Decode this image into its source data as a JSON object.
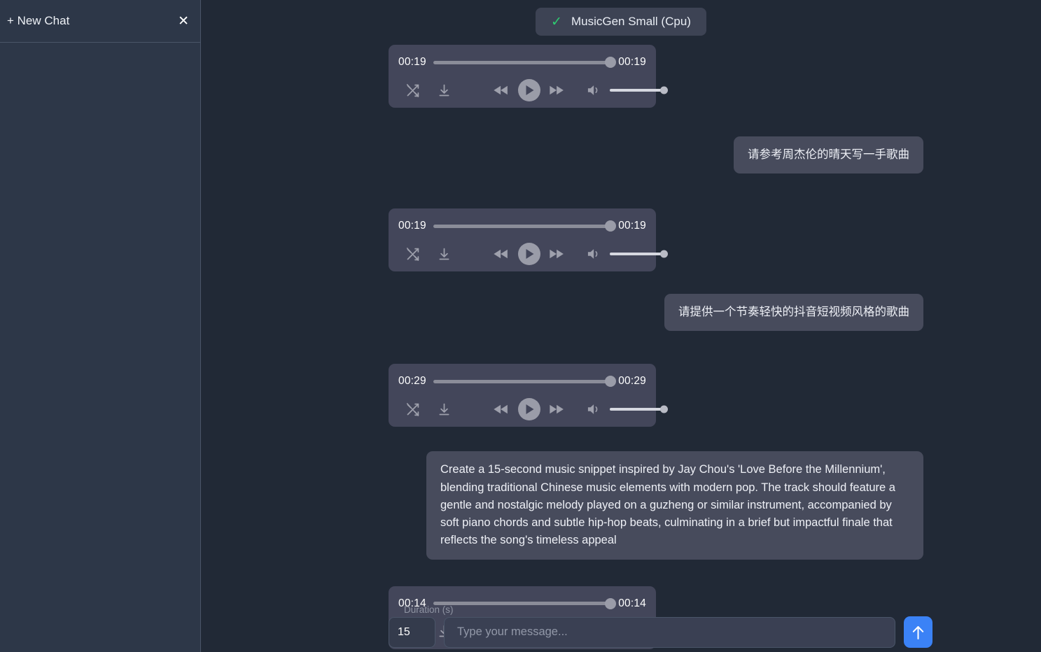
{
  "sidebar": {
    "new_chat_label": "+ New Chat",
    "close_icon": "close-icon"
  },
  "header": {
    "model_badge": {
      "check_icon": "check-icon",
      "label": "MusicGen Small (Cpu)"
    }
  },
  "conversation": [
    {
      "type": "audio",
      "align": "left",
      "current_time": "00:19",
      "total_time": "00:19",
      "progress_percent": 100,
      "volume_percent": 100
    },
    {
      "type": "message",
      "align": "right",
      "text": "请参考周杰伦的晴天写一手歌曲"
    },
    {
      "type": "audio",
      "align": "left",
      "current_time": "00:19",
      "total_time": "00:19",
      "progress_percent": 100,
      "volume_percent": 100
    },
    {
      "type": "message",
      "align": "right",
      "text": "请提供一个节奏轻快的抖音短视频风格的歌曲"
    },
    {
      "type": "audio",
      "align": "left",
      "current_time": "00:29",
      "total_time": "00:29",
      "progress_percent": 100,
      "volume_percent": 100
    },
    {
      "type": "message",
      "align": "right",
      "text": "Create a 15-second music snippet inspired by Jay Chou's 'Love Before the Millennium', blending traditional Chinese music elements with modern pop. The track should feature a gentle and nostalgic melody played on a guzheng or similar instrument, accompanied by soft piano chords and subtle hip-hop beats, culminating in a brief but impactful finale that reflects the song's timeless appeal"
    },
    {
      "type": "audio",
      "align": "left",
      "current_time": "00:14",
      "total_time": "00:14",
      "progress_percent": 100,
      "volume_percent": 100
    }
  ],
  "composer": {
    "duration_label": "Duration (s)",
    "duration_value": "15",
    "message_placeholder": "Type your message...",
    "send_icon": "arrow-up-icon"
  },
  "player_icons": {
    "shuffle": "shuffle-disabled-icon",
    "download": "download-icon",
    "rewind": "rewind-icon",
    "play": "play-icon",
    "forward": "fast-forward-icon",
    "volume": "volume-icon"
  },
  "colors": {
    "background": "#212936",
    "sidebar": "#2d3748",
    "player": "#43465a",
    "bubble": "#474b5c",
    "accent_send": "#3b82f6",
    "check_green": "#2ecc71"
  }
}
